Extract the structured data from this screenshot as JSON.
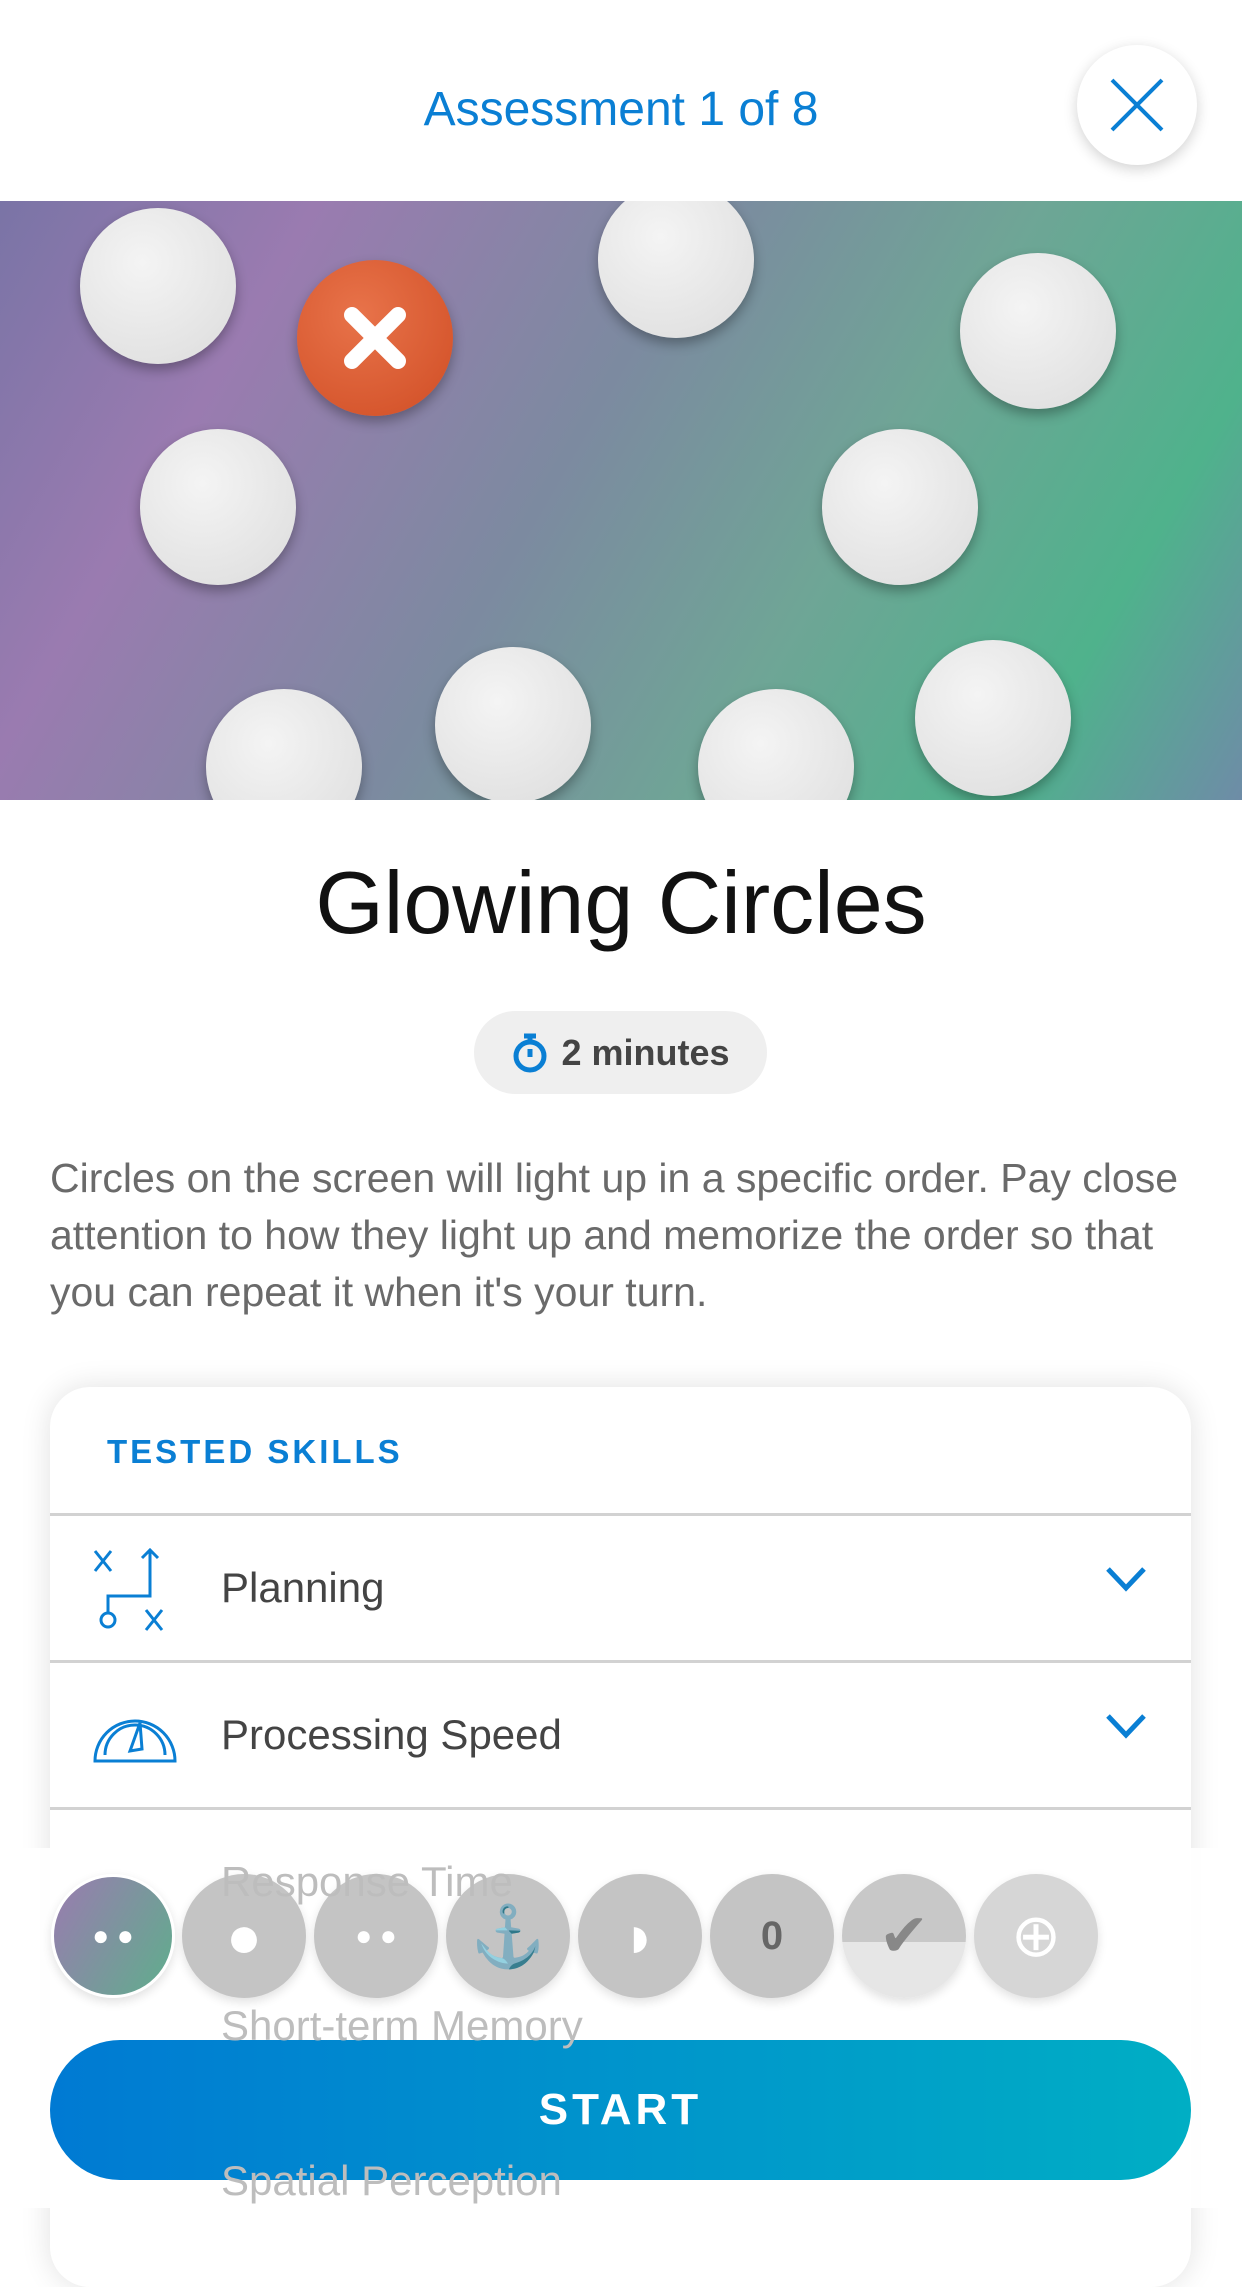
{
  "header": {
    "title": "Assessment 1 of 8",
    "close_icon": "close-icon"
  },
  "game": {
    "title": "Glowing Circles",
    "duration": "2 minutes",
    "duration_icon": "stopwatch-icon",
    "description": "Circles on the screen will light up in a specific order. Pay close attention to how they light up and memorize the order so that you can repeat it when it's your turn."
  },
  "skills": {
    "heading": "TESTED SKILLS",
    "items": [
      {
        "label": "Planning",
        "icon": "planning-icon"
      },
      {
        "label": "Processing Speed",
        "icon": "speedometer-icon"
      },
      {
        "label": "Response Time",
        "icon": "response-time-icon"
      },
      {
        "label": "Short-term Memory",
        "icon": "memory-icon"
      },
      {
        "label": "Spatial Perception",
        "icon": "spatial-icon"
      }
    ]
  },
  "assessments": {
    "current": 1,
    "total": 8,
    "thumbnails": [
      "glowing-circles",
      "circle-x",
      "circles",
      "anchor",
      "watermelon",
      "number-dial",
      "checkmark",
      "crosshair"
    ]
  },
  "start_label": "START",
  "colors": {
    "accent": "#0a7fd4",
    "button_start": "#007ad3",
    "button_end": "#00aec4",
    "error": "#d04d24"
  }
}
